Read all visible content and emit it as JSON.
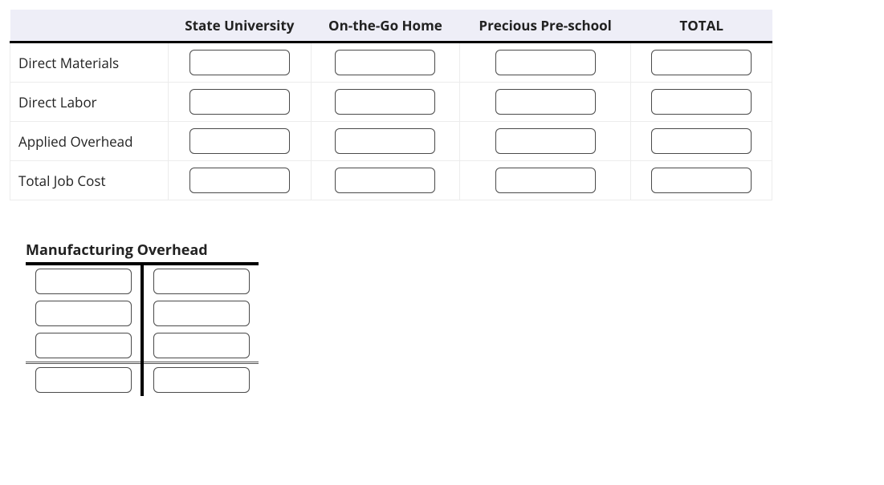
{
  "jobTable": {
    "headers": {
      "blank": "",
      "col1": "State University",
      "col2": "On-the-Go Home",
      "col3": "Precious Pre-school",
      "col4": "TOTAL"
    },
    "rows": [
      {
        "label": "Direct Materials",
        "state_university": "",
        "on_the_go_home": "",
        "precious_preschool": "",
        "total": ""
      },
      {
        "label": "Direct Labor",
        "state_university": "",
        "on_the_go_home": "",
        "precious_preschool": "",
        "total": ""
      },
      {
        "label": "Applied Overhead",
        "state_university": "",
        "on_the_go_home": "",
        "precious_preschool": "",
        "total": ""
      },
      {
        "label": "Total Job Cost",
        "state_university": "",
        "on_the_go_home": "",
        "precious_preschool": "",
        "total": ""
      }
    ]
  },
  "tAccount": {
    "title": "Manufacturing Overhead",
    "rows": [
      {
        "debit": "",
        "credit": ""
      },
      {
        "debit": "",
        "credit": ""
      },
      {
        "debit": "",
        "credit": ""
      }
    ],
    "totals": {
      "debit": "",
      "credit": ""
    }
  }
}
